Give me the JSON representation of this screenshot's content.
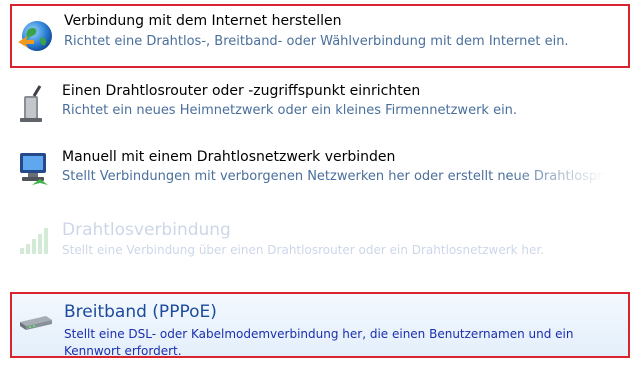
{
  "options": [
    {
      "title": "Verbindung mit dem Internet herstellen",
      "description": "Richtet eine Drahtlos-, Breitband- oder Wählverbindung mit dem Internet ein."
    },
    {
      "title": "Einen Drahtlosrouter oder -zugriffspunkt einrichten",
      "description": "Richtet ein neues Heimnetzwerk oder ein kleines Firmennetzwerk ein."
    },
    {
      "title": "Manuell mit einem Drahtlosnetzwerk verbinden",
      "description": "Stellt Verbindungen mit verborgenen Netzwerken her oder erstellt neue Drahtlosprofile."
    }
  ],
  "connections": [
    {
      "title": "Drahtlosverbindung",
      "description": "Stellt eine Verbindung über einen Drahtlosrouter oder ein Drahtlosnetzwerk her."
    },
    {
      "title": "Breitband (PPPoE)",
      "description": "Stellt eine DSL- oder Kabelmodemverbindung her, die einen Benutzernamen und ein Kennwort erfordert."
    }
  ],
  "icons": [
    "globe-icon",
    "router-icon",
    "wireless-computer-icon",
    "signal-bars-icon",
    "modem-icon"
  ],
  "colors": {
    "highlight_border": "#d9232e",
    "link_blue": "#1c4a9c",
    "description": "#4a6f9c"
  }
}
